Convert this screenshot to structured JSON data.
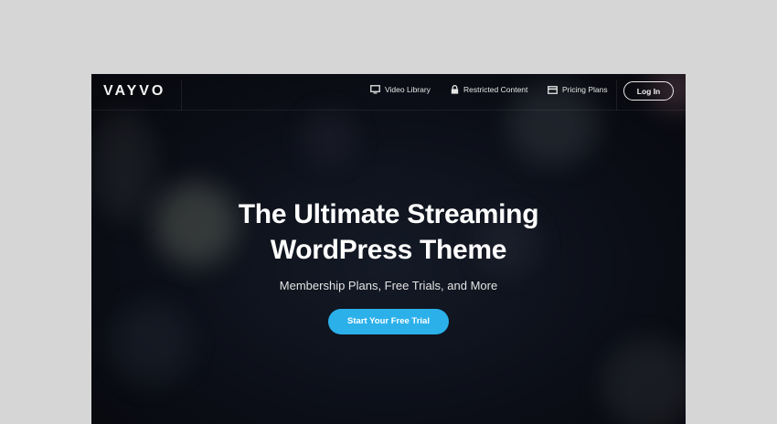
{
  "brand": {
    "logo_text": "VAYVO"
  },
  "nav": {
    "items": [
      {
        "label": "Video Library",
        "icon": "monitor-icon"
      },
      {
        "label": "Restricted Content",
        "icon": "lock-icon"
      },
      {
        "label": "Pricing Plans",
        "icon": "credit-card-icon"
      }
    ],
    "login_label": "Log In"
  },
  "hero": {
    "title_line1": "The Ultimate Streaming",
    "title_line2": "WordPress Theme",
    "subtitle": "Membership Plans, Free Trials, and More",
    "cta_label": "Start Your Free Trial"
  },
  "colors": {
    "page_background": "#d6d6d6",
    "hero_background": "#0c0f18",
    "accent": "#2bb0ea",
    "text": "#ffffff"
  }
}
